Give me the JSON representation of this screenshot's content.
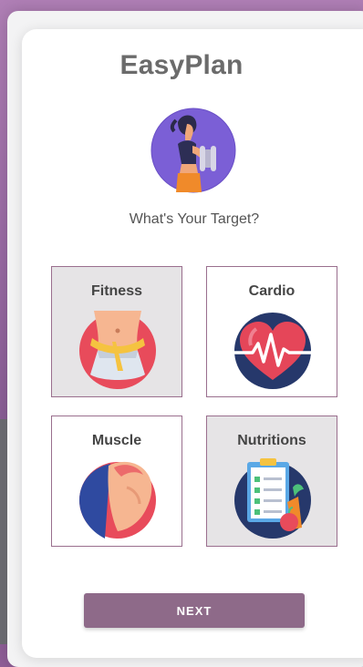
{
  "app": {
    "title": "EasyPlan"
  },
  "prompt": "What's Your Target?",
  "targets": [
    {
      "label": "Fitness",
      "icon": "waist-measure-icon",
      "selected": true
    },
    {
      "label": "Cardio",
      "icon": "heartbeat-icon",
      "selected": false
    },
    {
      "label": "Muscle",
      "icon": "flexed-arm-icon",
      "selected": false
    },
    {
      "label": "Nutritions",
      "icon": "diet-checklist-icon",
      "selected": true
    }
  ],
  "actions": {
    "next_label": "NEXT"
  },
  "colors": {
    "accent": "#8e6a89",
    "tile_border": "#9a6f8e",
    "selected_tile": "#e6e4e6"
  }
}
